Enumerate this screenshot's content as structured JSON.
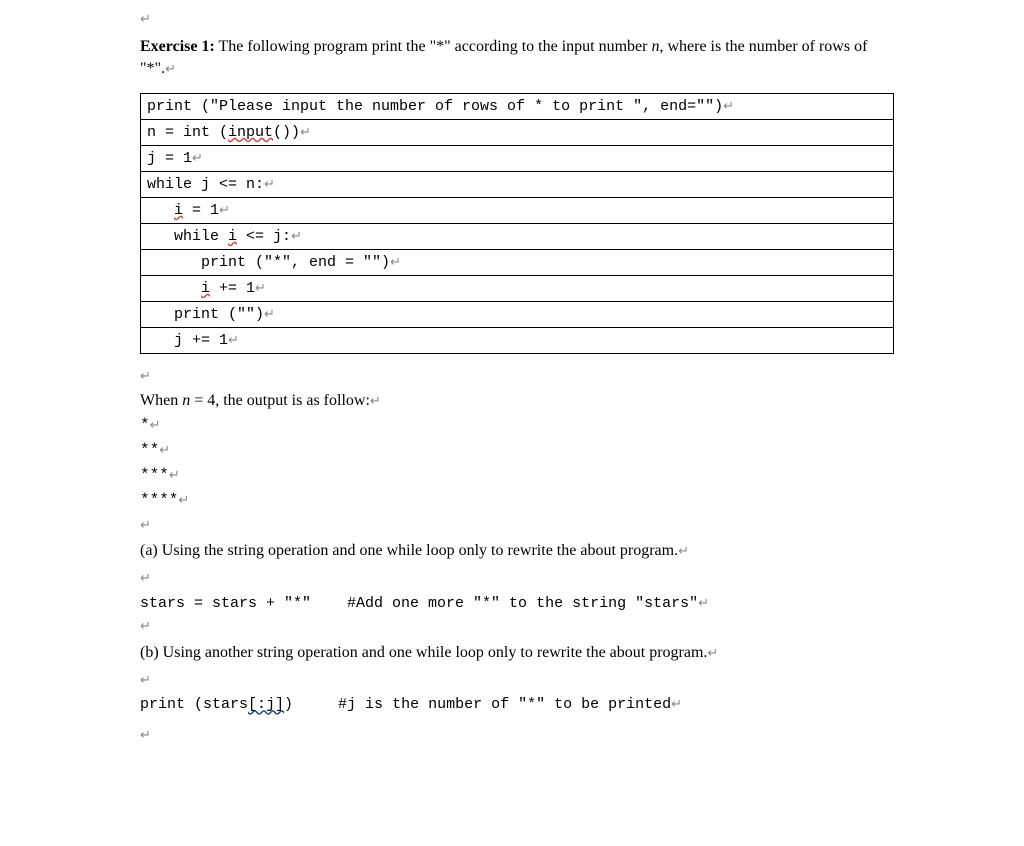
{
  "glyphs": {
    "enter": "↵"
  },
  "exercise": {
    "label": "Exercise 1:",
    "text_part1": " The following program print the \"*\" according to the input number ",
    "n_var": "n",
    "text_part2": ", where is the number of rows of \"*\"."
  },
  "code": {
    "l1_a": "print (\"Please input the number of rows of * to print \", end=\"\")",
    "l2_a": "n = int (",
    "l2_b": "input",
    "l2_c": "())",
    "l3": "j = 1",
    "l4": "while j <= n:",
    "l5_a": "   ",
    "l5_b": "i",
    "l5_c": " = 1",
    "l6_a": "   while ",
    "l6_b": "i",
    "l6_c": " <= j:",
    "l7": "      print (\"*\", end = \"\")",
    "l8_a": "      ",
    "l8_b": "i",
    "l8_c": " += 1",
    "l9": "   print (\"\")",
    "l10": "   j += 1"
  },
  "output": {
    "intro_a": "When ",
    "intro_n": "n",
    "intro_b": " = 4, the output is as follow:",
    "r1": "*",
    "r2": "**",
    "r3": "***",
    "r4": "****"
  },
  "part_a": {
    "text": "(a) Using the string operation and one while loop only to rewrite the about program.",
    "hint_a": "stars = stars + \"*\"    #Add one more \"*\" to the string \"stars\""
  },
  "part_b": {
    "text": "(b) Using another string operation and one while loop only to rewrite the about program.",
    "hint_a": "print (stars",
    "hint_b": "[:j]",
    "hint_c": ")     #j is the number of \"*\" to be printed"
  }
}
